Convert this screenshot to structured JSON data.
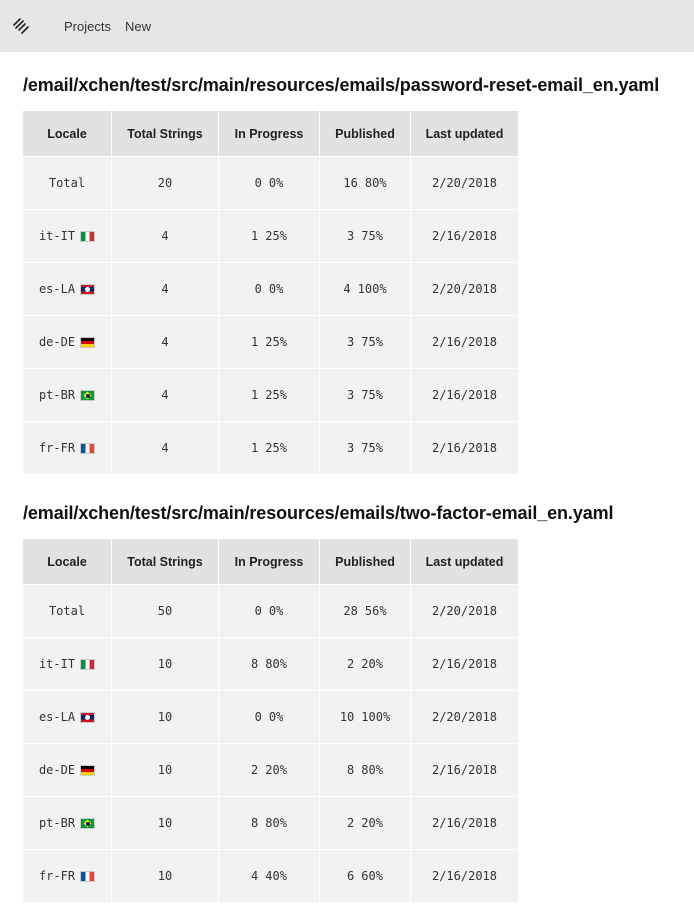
{
  "nav": {
    "logo_icon": "squarespace-logo-icon",
    "items": [
      {
        "label": "Projects"
      },
      {
        "label": "New"
      }
    ]
  },
  "columns": [
    "Locale",
    "Total Strings",
    "In Progress",
    "Published",
    "Last updated"
  ],
  "colors": {
    "green": "#2fc36b",
    "orange": "#e8842c",
    "red": "#e8343d"
  },
  "files": [
    {
      "path": "/email/xchen/test/src/main/resources/emails/password-reset-email_en.yaml",
      "rows": [
        {
          "locale": "Total",
          "flag": "",
          "total": "20",
          "ip_n": "0",
          "ip_p": "0%",
          "pub_n": "16",
          "pub_p": "80%",
          "pub_color": "green",
          "updated": "2/20/2018"
        },
        {
          "locale": "it-IT",
          "flag": "it",
          "total": "4",
          "ip_n": "1",
          "ip_p": "25%",
          "pub_n": "3",
          "pub_p": "75%",
          "pub_color": "green",
          "updated": "2/16/2018"
        },
        {
          "locale": "es-LA",
          "flag": "la",
          "total": "4",
          "ip_n": "0",
          "ip_p": "0%",
          "pub_n": "4",
          "pub_p": "100%",
          "pub_color": "green",
          "updated": "2/20/2018"
        },
        {
          "locale": "de-DE",
          "flag": "de",
          "total": "4",
          "ip_n": "1",
          "ip_p": "25%",
          "pub_n": "3",
          "pub_p": "75%",
          "pub_color": "green",
          "updated": "2/16/2018"
        },
        {
          "locale": "pt-BR",
          "flag": "br",
          "total": "4",
          "ip_n": "1",
          "ip_p": "25%",
          "pub_n": "3",
          "pub_p": "75%",
          "pub_color": "green",
          "updated": "2/16/2018"
        },
        {
          "locale": "fr-FR",
          "flag": "fr",
          "total": "4",
          "ip_n": "1",
          "ip_p": "25%",
          "pub_n": "3",
          "pub_p": "75%",
          "pub_color": "green",
          "updated": "2/16/2018"
        }
      ]
    },
    {
      "path": "/email/xchen/test/src/main/resources/emails/two-factor-email_en.yaml",
      "rows": [
        {
          "locale": "Total",
          "flag": "",
          "total": "50",
          "ip_n": "0",
          "ip_p": "0%",
          "pub_n": "28",
          "pub_p": "56%",
          "pub_color": "orange",
          "updated": "2/20/2018"
        },
        {
          "locale": "it-IT",
          "flag": "it",
          "total": "10",
          "ip_n": "8",
          "ip_p": "80%",
          "pub_n": "2",
          "pub_p": "20%",
          "pub_color": "red",
          "updated": "2/16/2018"
        },
        {
          "locale": "es-LA",
          "flag": "la",
          "total": "10",
          "ip_n": "0",
          "ip_p": "0%",
          "pub_n": "10",
          "pub_p": "100%",
          "pub_color": "green",
          "updated": "2/20/2018"
        },
        {
          "locale": "de-DE",
          "flag": "de",
          "total": "10",
          "ip_n": "2",
          "ip_p": "20%",
          "pub_n": "8",
          "pub_p": "80%",
          "pub_color": "green",
          "updated": "2/16/2018"
        },
        {
          "locale": "pt-BR",
          "flag": "br",
          "total": "10",
          "ip_n": "8",
          "ip_p": "80%",
          "pub_n": "2",
          "pub_p": "20%",
          "pub_color": "red",
          "updated": "2/16/2018"
        },
        {
          "locale": "fr-FR",
          "flag": "fr",
          "total": "10",
          "ip_n": "4",
          "ip_p": "40%",
          "pub_n": "6",
          "pub_p": "60%",
          "pub_color": "orange",
          "updated": "2/16/2018"
        }
      ]
    }
  ]
}
